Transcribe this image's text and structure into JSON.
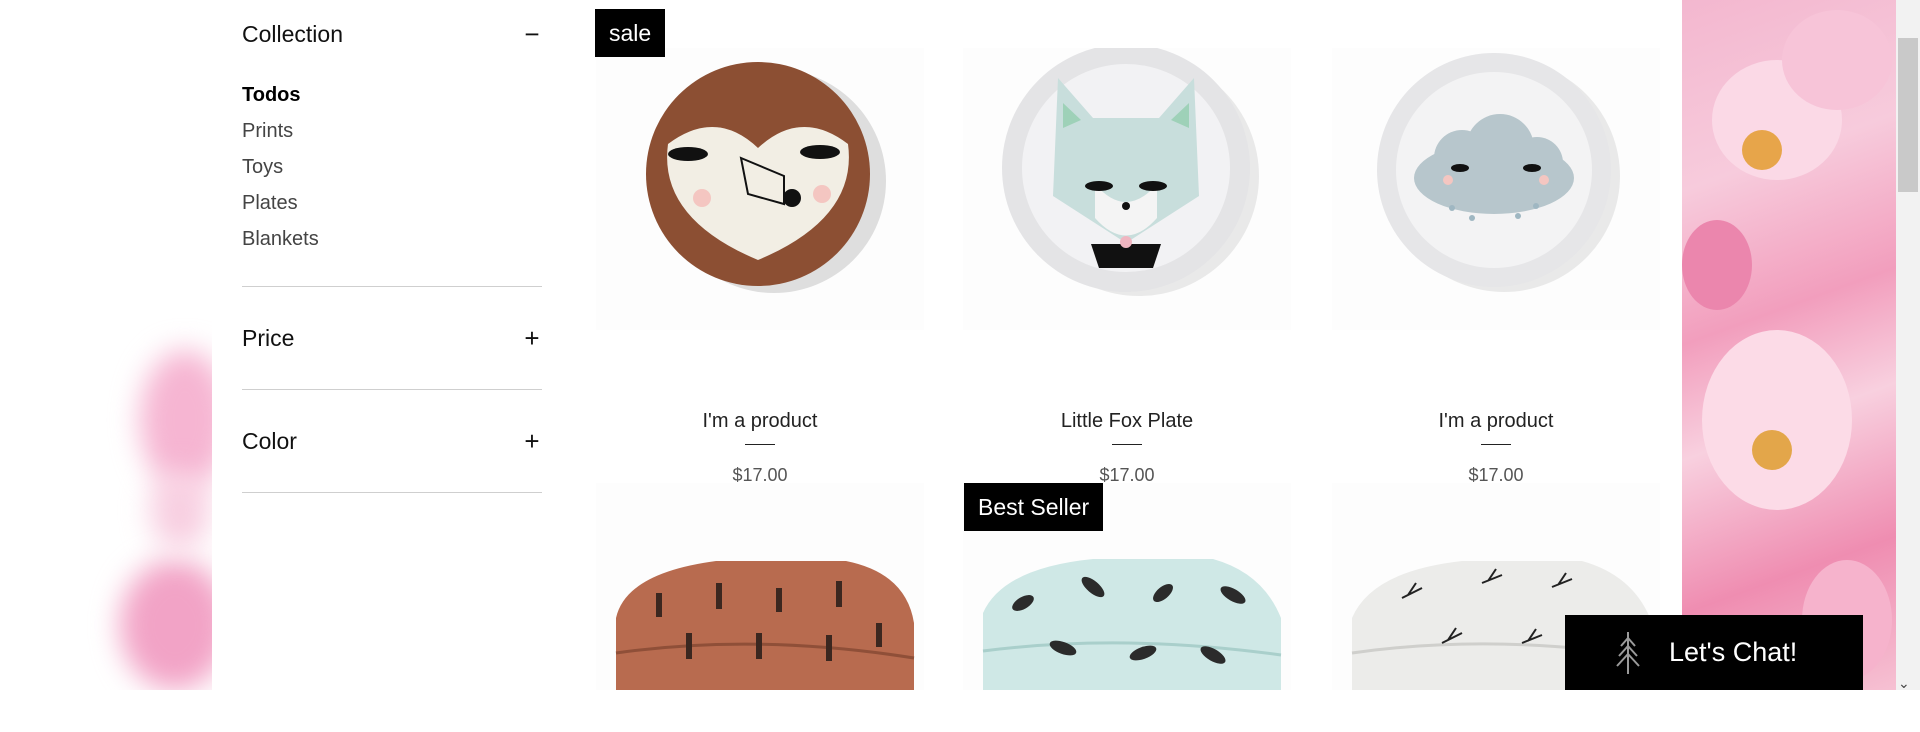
{
  "sidebar": {
    "collection_title": "Collection",
    "collection_toggle": "−",
    "items": [
      {
        "label": "Todos",
        "active": true
      },
      {
        "label": "Prints",
        "active": false
      },
      {
        "label": "Toys",
        "active": false
      },
      {
        "label": "Plates",
        "active": false
      },
      {
        "label": "Blankets",
        "active": false
      }
    ],
    "price_title": "Price",
    "price_toggle": "+",
    "color_title": "Color",
    "color_toggle": "+"
  },
  "products": [
    {
      "name": "I'm a product",
      "price": "$17.00",
      "ribbon": "sale",
      "image": "owl-plate"
    },
    {
      "name": "Little Fox Plate",
      "price": "$17.00",
      "ribbon": "",
      "image": "fox-plate"
    },
    {
      "name": "I'm a product",
      "price": "$17.00",
      "ribbon": "",
      "image": "cloud-plate"
    },
    {
      "name": "",
      "price": "",
      "ribbon": "",
      "image": "cactus-blanket"
    },
    {
      "name": "",
      "price": "",
      "ribbon": "Best Seller",
      "image": "feather-blanket"
    },
    {
      "name": "",
      "price": "",
      "ribbon": "",
      "image": "tree-blanket"
    }
  ],
  "chat": {
    "label": "Let's Chat!",
    "icon": "pine-tree-icon"
  },
  "scrollbar": {
    "down_arrow": "⌄"
  }
}
